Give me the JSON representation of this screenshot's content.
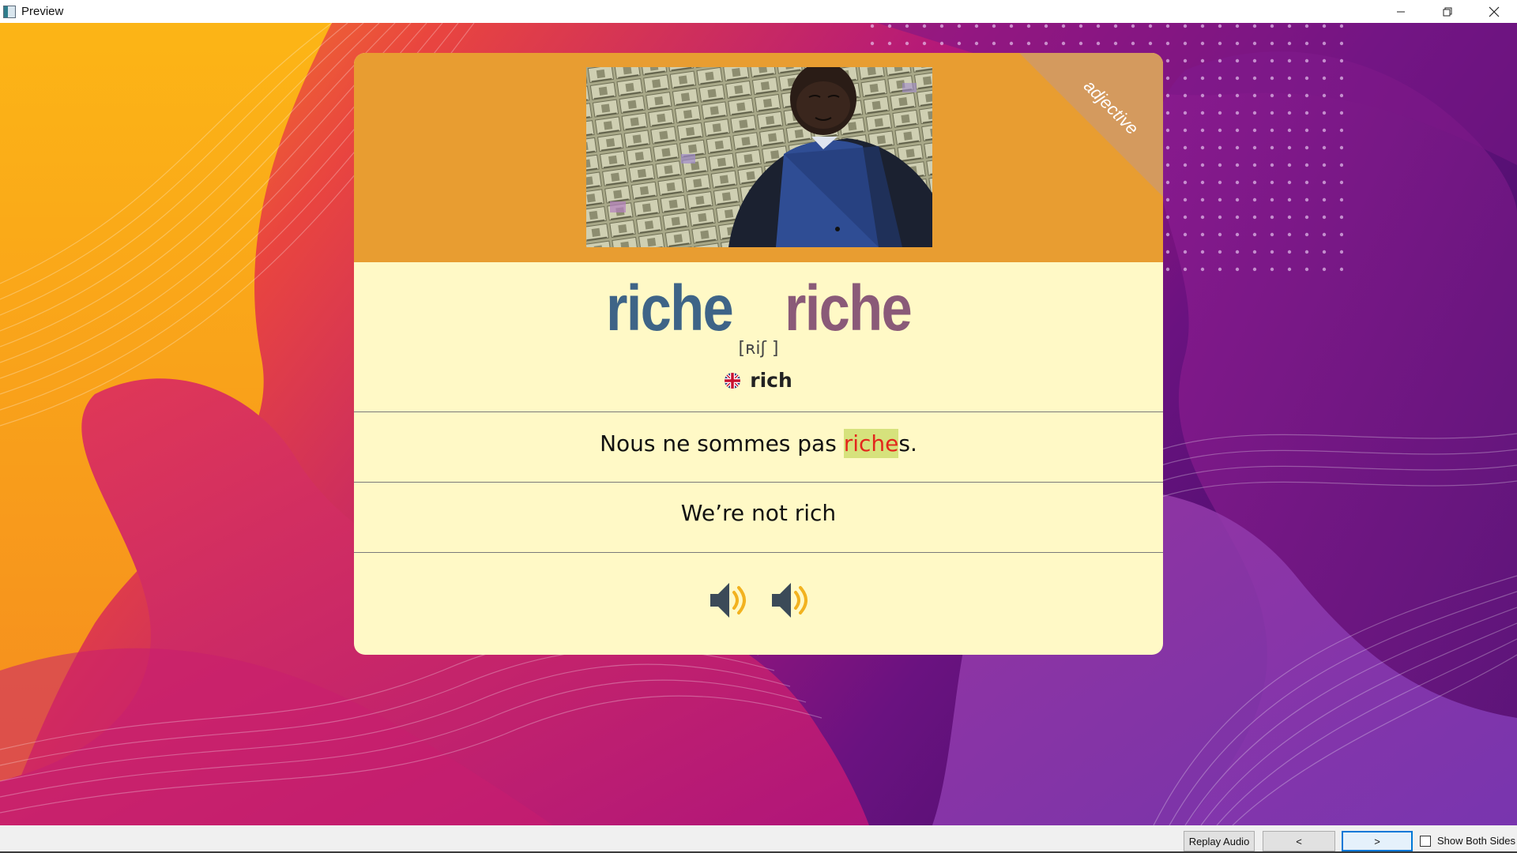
{
  "window": {
    "title": "Preview"
  },
  "card": {
    "part_of_speech": "adjective",
    "word_masculine": "riche",
    "word_feminine": "riche",
    "phonetic": "[ʀiʃ ]",
    "translation": "rich",
    "translation_flag_icon": "uk-flag-icon",
    "example_before": "Nous ne sommes pas ",
    "example_highlight": "riche",
    "example_after": "s.",
    "example_translation": "We’re not rich",
    "audio_icons": [
      "speaker-icon",
      "speaker-icon"
    ]
  },
  "colors": {
    "card_header": "#e89d31",
    "card_body": "#fff9c6",
    "word_masculine": "#3e6487",
    "word_feminine": "#8a5a78",
    "highlight_bg": "#d6e27c",
    "highlight_text": "#e3261c"
  },
  "toolbar": {
    "replay_label": "Replay Audio",
    "prev_label": "<",
    "next_label": ">",
    "show_both_label": "Show Both Sides",
    "show_both_checked": false
  }
}
